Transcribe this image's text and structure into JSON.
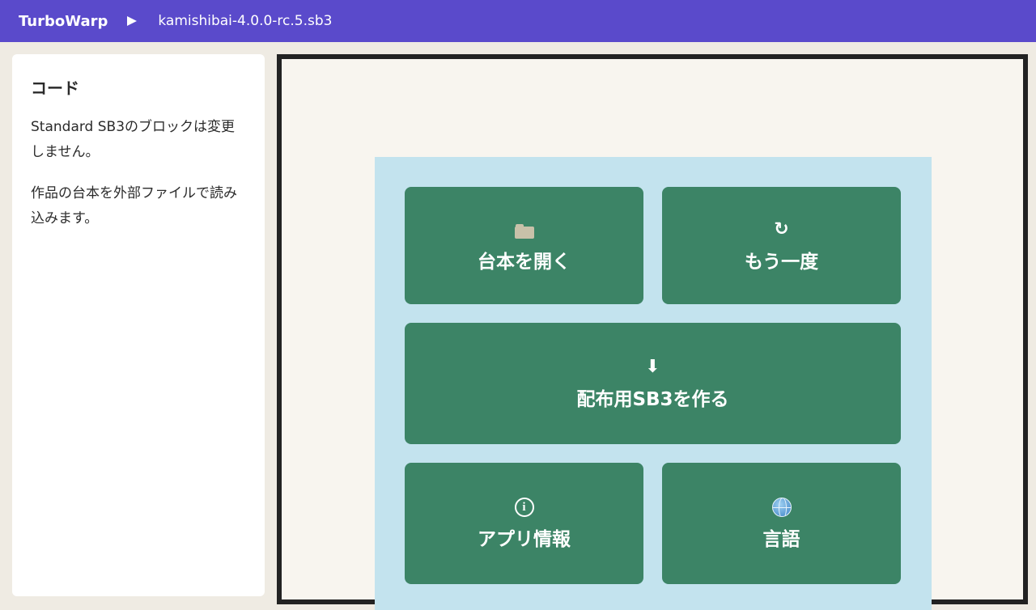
{
  "menubar": {
    "brand": "TurboWarp",
    "play_icon": "play-icon",
    "filename": "kamishibai-4.0.0-rc.5.sb3"
  },
  "sidebar": {
    "title": "コード",
    "paragraphs": [
      "Standard SB3のブロックは変更しません。",
      "作品の台本を外部ファイルで読み込みます。"
    ]
  },
  "stage": {
    "buttons": {
      "open": {
        "icon": "folder-icon",
        "label": "台本を開く"
      },
      "retry": {
        "icon": "refresh-icon",
        "glyph": "↻",
        "label": "もう一度"
      },
      "export": {
        "icon": "download-arrow-icon",
        "glyph": "⬇",
        "label": "配布用SB3を作る"
      },
      "about": {
        "icon": "info-icon",
        "glyph": "i",
        "label": "アプリ情報"
      },
      "language": {
        "icon": "globe-icon",
        "label": "言語"
      }
    },
    "colors": {
      "panel": "#c3e3ee",
      "button": "#3c8466",
      "menubar": "#5a4acb"
    }
  }
}
